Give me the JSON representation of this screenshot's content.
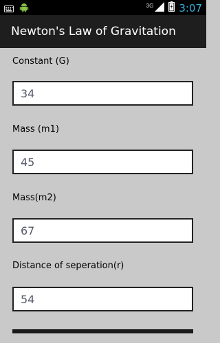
{
  "status_bar": {
    "network": "3G",
    "time": "3:07",
    "icons": [
      "keyboard-icon",
      "android-icon",
      "signal-icon",
      "battery-icon"
    ]
  },
  "action_bar": {
    "title": "Newton's Law of Gravitation"
  },
  "fields": [
    {
      "label": "Constant  (G)",
      "value": "34"
    },
    {
      "label": "Mass  (m1)",
      "value": "45"
    },
    {
      "label": "Mass(m2)",
      "value": "67"
    },
    {
      "label": "Distance of seperation(r)",
      "value": "54"
    }
  ],
  "colors": {
    "background": "#c9c9c9",
    "action_bar": "#1e1e1e",
    "clock": "#33b5e5",
    "input_text": "#555a6b"
  }
}
